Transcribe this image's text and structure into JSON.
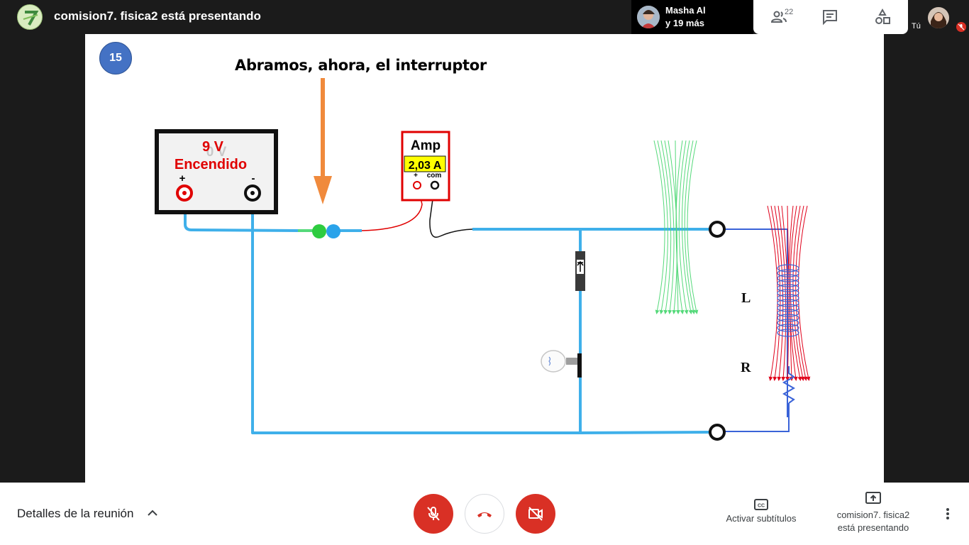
{
  "topbar": {
    "presenter_title": "comision7. fisica2 está presentando",
    "participant_name": "Masha Al",
    "participant_more": "y 19 más",
    "people_count": "22",
    "self_label": "Tú"
  },
  "slide": {
    "number": "15",
    "title": "Abramos, ahora, el interruptor",
    "battery_voltage_ghost": "0 V",
    "battery_voltage": "9 V",
    "battery_state": "Encendido",
    "battery_plus": "+",
    "battery_minus": "-",
    "ammeter_label": "Amp",
    "ammeter_reading": "2,03 A",
    "ammeter_plus": "+",
    "ammeter_com": "com",
    "inductor_label": "L",
    "resistor_label": "R",
    "colors": {
      "wire": "#3fb0ea",
      "red_probe": "#e00000",
      "arrow": "#f08a3c",
      "green_field": "#55d97a",
      "red_field": "#e0001a",
      "coil": "#3a63d8"
    }
  },
  "bottombar": {
    "meeting_details": "Detalles de la reunión",
    "captions_label": "Activar subtítulos",
    "present_line1": "comision7. fisica2",
    "present_line2": "está presentando"
  }
}
